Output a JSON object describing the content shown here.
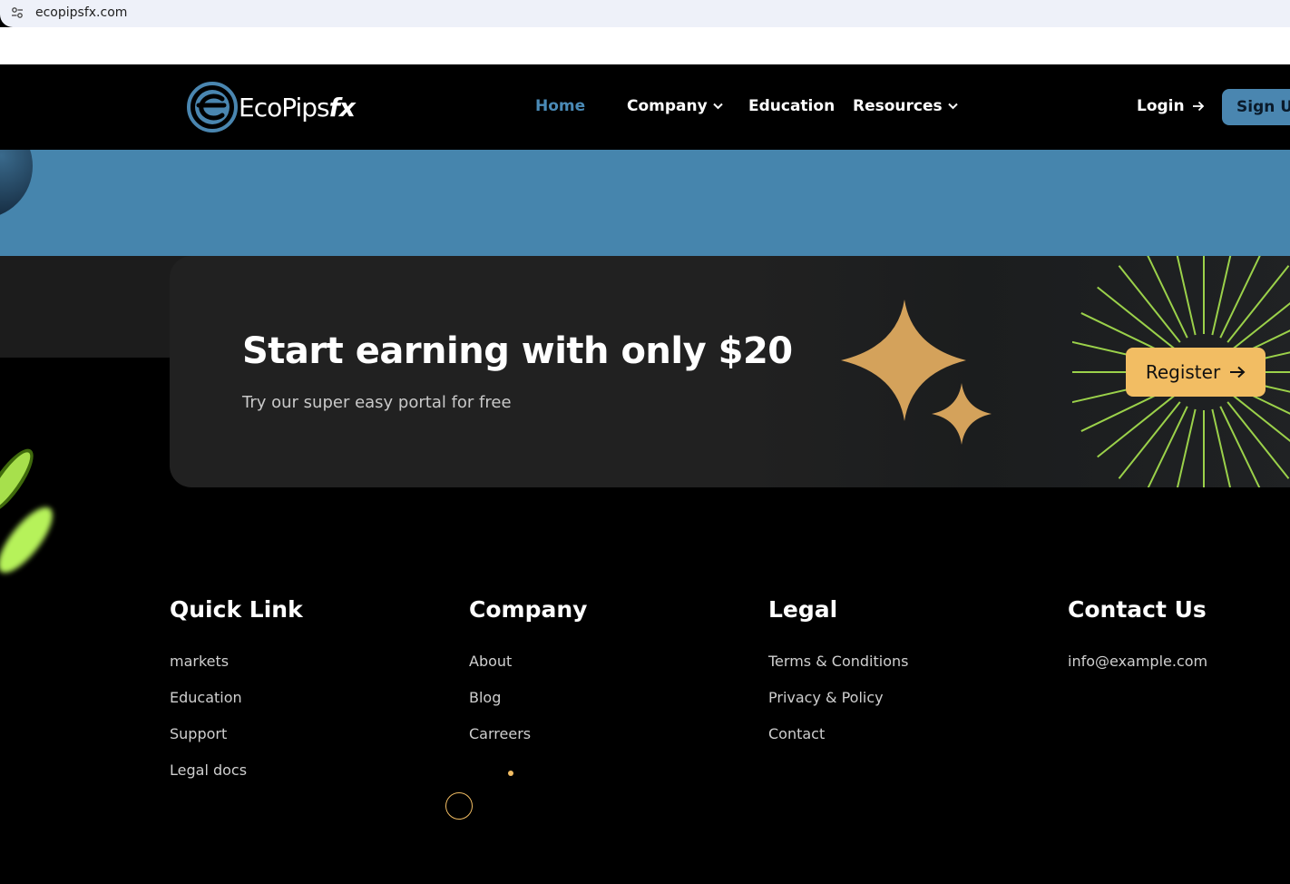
{
  "browser": {
    "url": "ecopipsfx.com",
    "site_icon": "tune-icon"
  },
  "header": {
    "logo_text": "EcoPips",
    "logo_suffix": "fx",
    "nav": [
      {
        "label": "Home",
        "active": true
      },
      {
        "label": "Company",
        "dropdown": true
      },
      {
        "label": "Education"
      },
      {
        "label": "Resources",
        "dropdown": true
      }
    ],
    "login_label": "Login",
    "signup_label": "Sign Up"
  },
  "cta": {
    "title": "Start earning with only $20",
    "subtitle": "Try our super easy portal for free",
    "button_label": "Register"
  },
  "footer": {
    "columns": [
      {
        "title": "Quick Link",
        "links": [
          "markets",
          "Education",
          "Support",
          "Legal docs"
        ]
      },
      {
        "title": "Company",
        "links": [
          "About",
          "Blog",
          "Carreers"
        ]
      },
      {
        "title": "Legal",
        "links": [
          "Terms & Conditions",
          "Privacy & Policy",
          "Contact"
        ]
      },
      {
        "title": "Contact Us",
        "links": [
          "info@example.com"
        ]
      }
    ]
  },
  "colors": {
    "accent_blue": "#4685ad",
    "accent_gold": "#f2bd63",
    "burst_green": "#9bd14a"
  }
}
